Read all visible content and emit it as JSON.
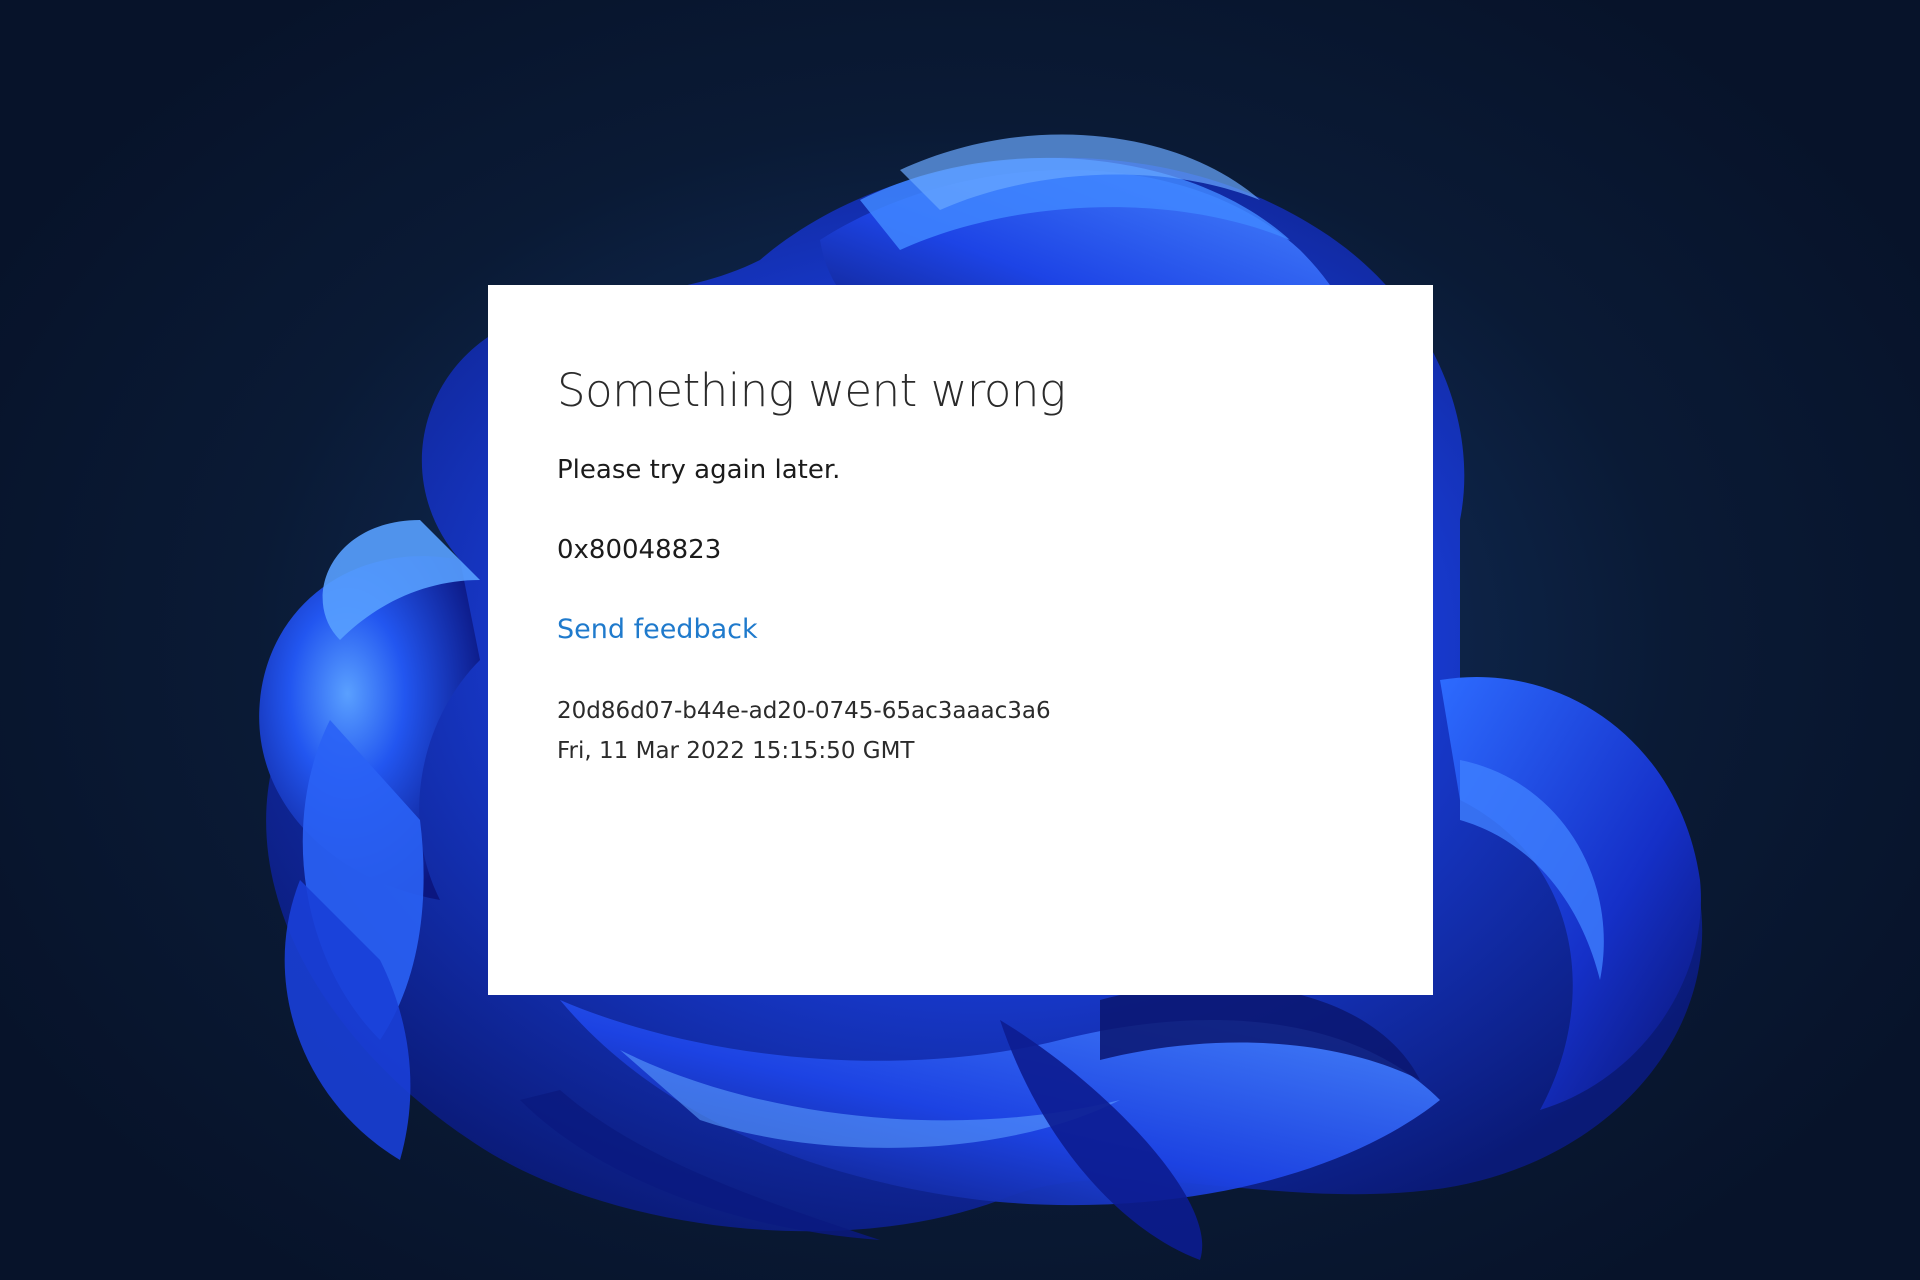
{
  "dialog": {
    "title": "Something went wrong",
    "message": "Please try again later.",
    "error_code": "0x80048823",
    "feedback_link": "Send feedback",
    "correlation_id": "20d86d07-b44e-ad20-0745-65ac3aaac3a6",
    "timestamp": "Fri, 11 Mar 2022 15:15:50 GMT"
  },
  "colors": {
    "link": "#1f7acc",
    "dialog_background": "#ffffff",
    "wallpaper_dark": "#07132a",
    "wallpaper_bloom": "#1e4bff"
  }
}
